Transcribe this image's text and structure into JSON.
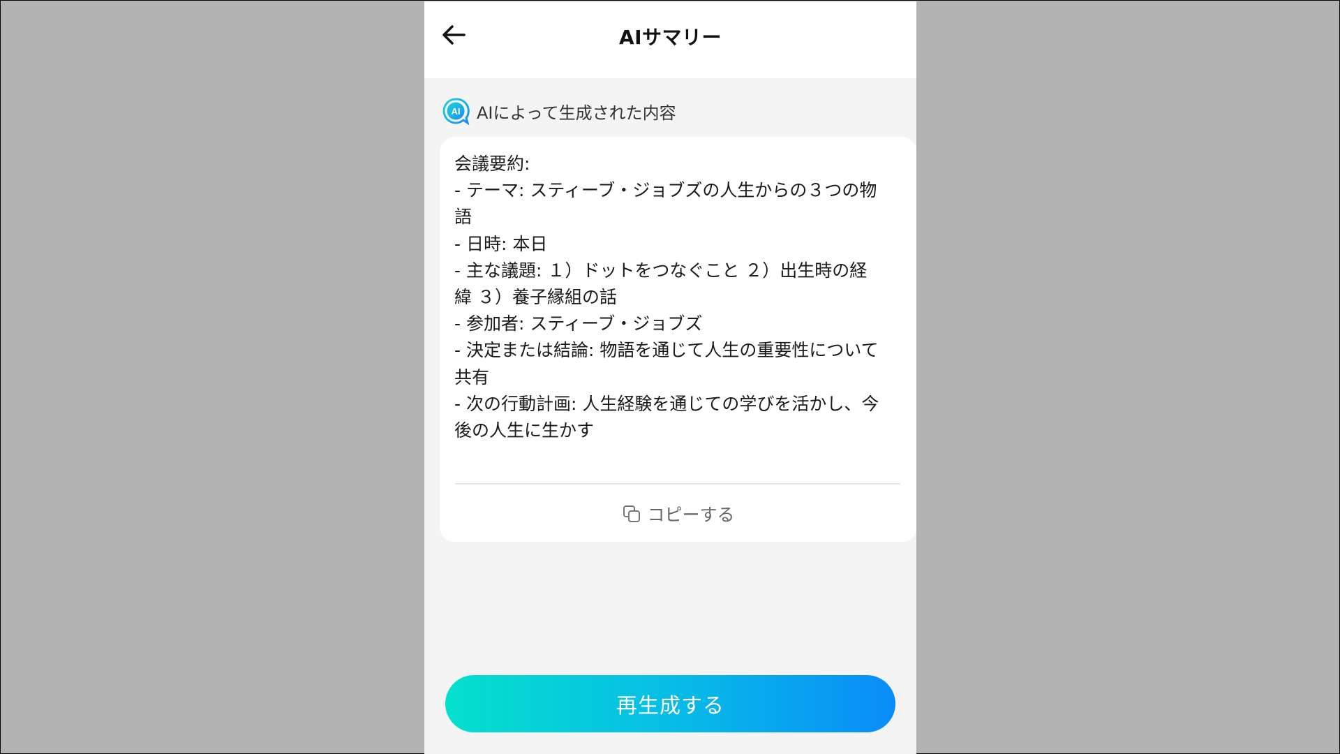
{
  "header": {
    "title": "AIサマリー",
    "back_icon": "arrow-left-icon"
  },
  "source": {
    "badge_text": "AI",
    "label": "AIによって生成された内容",
    "badge_color": "#1fb8e8"
  },
  "summary": {
    "text": "会議要約:\n- テーマ: スティーブ・ジョブズの人生からの３つの物\n語\n- 日時: 本日\n- 主な議題: １）ドットをつなぐこと ２）出生時の経\n緯 ３）養子縁組の話\n- 参加者: スティーブ・ジョブズ\n- 決定または結論: 物語を通じて人生の重要性について\n共有\n- 次の行動計画: 人生経験を通じての学びを活かし、今\n後の人生に生かす"
  },
  "copy": {
    "label": "コピーする",
    "icon": "copy-icon"
  },
  "regenerate": {
    "label": "再生成する",
    "gradient_start": "#05e0cc",
    "gradient_end": "#0a8cf8"
  },
  "colors": {
    "backdrop": "#b3b3b3",
    "app_background": "#f4f4f4",
    "card_background": "#ffffff"
  }
}
